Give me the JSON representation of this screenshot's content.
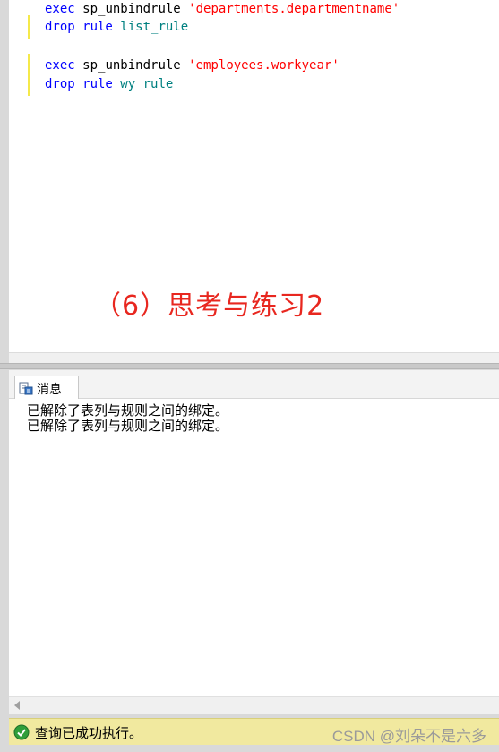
{
  "editor": {
    "lines": [
      {
        "kw": "exec",
        "proc": "sp_unbindrule",
        "str": "'departments.departmentname'"
      },
      {
        "kw": "drop rule",
        "obj": "list_rule"
      },
      {
        "kw": "exec",
        "proc": "sp_unbindrule",
        "str": "'employees.workyear'"
      },
      {
        "kw": "drop rule",
        "obj": "wy_rule"
      }
    ],
    "overlay_title": "（6）思考与练习2"
  },
  "results": {
    "tab_label": "消息",
    "messages": [
      "已解除了表列与规则之间的绑定。",
      "已解除了表列与规则之间的绑定。"
    ]
  },
  "status": {
    "text": "查询已成功执行。",
    "watermark": "CSDN @刘朵不是六多"
  },
  "colors": {
    "keyword": "#0000ff",
    "string": "#ff0000",
    "object": "#008080",
    "overlay": "#e8271f",
    "status_bg": "#f1e99f"
  },
  "icons": {
    "fold": "collapse-box-icon",
    "tab": "messages-icon",
    "status": "success-check-icon"
  }
}
